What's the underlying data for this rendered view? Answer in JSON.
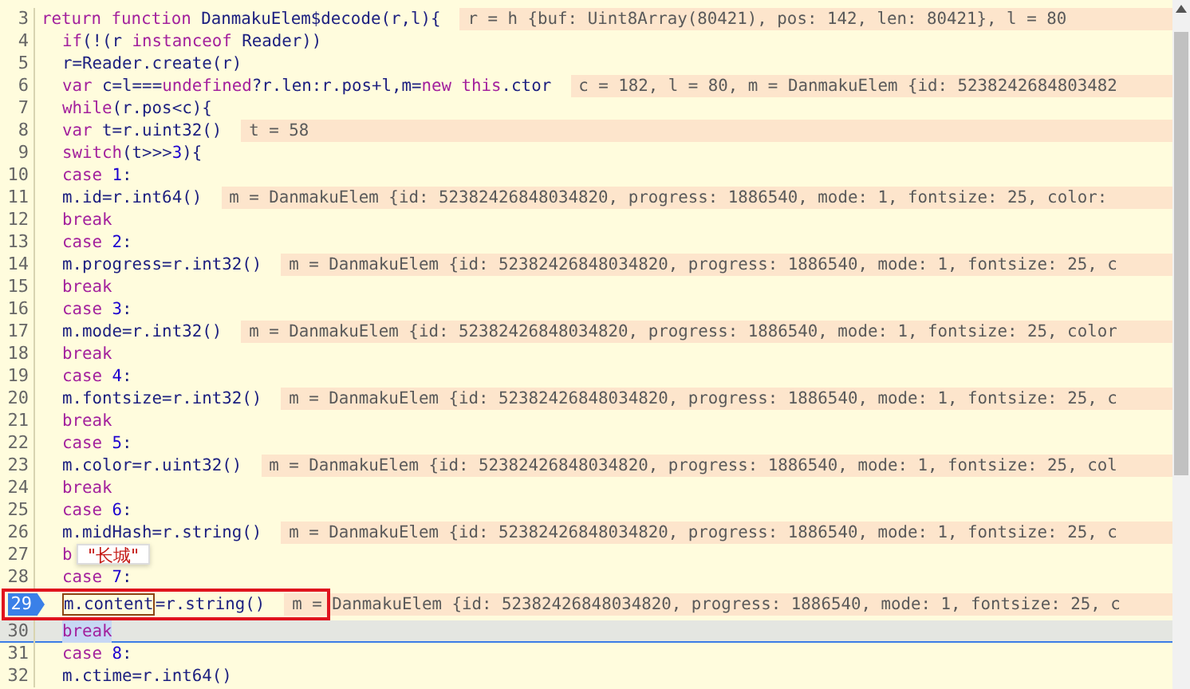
{
  "editor": {
    "lines": [
      {
        "number": "3",
        "paused": false,
        "highlighted": false,
        "tokens": [
          {
            "text": "return function",
            "kind": "keyword"
          },
          {
            "text": " DanmakuElem$decode(r,l){",
            "kind": "plain"
          }
        ],
        "value": "r = h {buf: Uint8Array(80421), pos: 142, len: 80421}, l = 80",
        "children": [
          {
            "number": "4",
            "paused": false,
            "highlighted": false,
            "tokens": [
              {
                "text": "if",
                "kind": "keyword"
              },
              {
                "text": "(!(r ",
                "kind": "plain"
              },
              {
                "text": "instanceof",
                "kind": "keyword"
              },
              {
                "text": " Reader))",
                "kind": "plain"
              }
            ]
          },
          {
            "number": "5",
            "paused": false,
            "highlighted": false,
            "tokens": [
              {
                "text": "r=Reader.create(r)",
                "kind": "plain"
              }
            ]
          },
          {
            "number": "6",
            "paused": false,
            "highlighted": false,
            "tokens": [
              {
                "text": "var",
                "kind": "keyword"
              },
              {
                "text": " c=l===",
                "kind": "plain"
              },
              {
                "text": "undefined",
                "kind": "keyword"
              },
              {
                "text": "?r.len:r.pos+l,m=",
                "kind": "plain"
              },
              {
                "text": "new this",
                "kind": "keyword"
              },
              {
                "text": ".ctor",
                "kind": "plain"
              }
            ],
            "value": "c = 182, l = 80, m = DanmakuElem {id: 5238242684803482"
          },
          {
            "number": "7",
            "paused": false,
            "highlighted": false,
            "tokens": [
              {
                "text": "while",
                "kind": "keyword"
              },
              {
                "text": "(r.pos<c){",
                "kind": "plain"
              }
            ]
          },
          {
            "number": "8",
            "paused": false,
            "highlighted": false,
            "tokens": [
              {
                "text": "var",
                "kind": "keyword"
              },
              {
                "text": " t=r.uint32()",
                "kind": "plain"
              }
            ],
            "value": "t = 58"
          },
          {
            "number": "9",
            "paused": false,
            "highlighted": false,
            "tokens": [
              {
                "text": "switch",
                "kind": "keyword"
              },
              {
                "text": "(t>>>",
                "kind": "plain"
              },
              {
                "text": "3",
                "kind": "number"
              },
              {
                "text": "){",
                "kind": "plain"
              }
            ]
          },
          {
            "number": "10",
            "paused": false,
            "highlighted": false,
            "tokens": [
              {
                "text": "case ",
                "kind": "keyword"
              },
              {
                "text": "1",
                "kind": "number"
              },
              {
                "text": ":",
                "kind": "plain"
              }
            ]
          },
          {
            "number": "11",
            "paused": false,
            "highlighted": false,
            "tokens": [
              {
                "text": "m.id=r.int64()",
                "kind": "plain"
              }
            ],
            "value": "m = DanmakuElem {id: 52382426848034820, progress: 1886540, mode: 1, fontsize: 25, color:"
          },
          {
            "number": "12",
            "paused": false,
            "highlighted": false,
            "tokens": [
              {
                "text": "break",
                "kind": "keyword"
              }
            ]
          },
          {
            "number": "13",
            "paused": false,
            "highlighted": false,
            "tokens": [
              {
                "text": "case ",
                "kind": "keyword"
              },
              {
                "text": "2",
                "kind": "number"
              },
              {
                "text": ":",
                "kind": "plain"
              }
            ]
          },
          {
            "number": "14",
            "paused": false,
            "highlighted": false,
            "tokens": [
              {
                "text": "m.progress=r.int32()",
                "kind": "plain"
              }
            ],
            "value": "m = DanmakuElem {id: 52382426848034820, progress: 1886540, mode: 1, fontsize: 25, c"
          },
          {
            "number": "15",
            "paused": false,
            "highlighted": false,
            "tokens": [
              {
                "text": "break",
                "kind": "keyword"
              }
            ]
          },
          {
            "number": "16",
            "paused": false,
            "highlighted": false,
            "tokens": [
              {
                "text": "case ",
                "kind": "keyword"
              },
              {
                "text": "3",
                "kind": "number"
              },
              {
                "text": ":",
                "kind": "plain"
              }
            ]
          },
          {
            "number": "17",
            "paused": false,
            "highlighted": false,
            "tokens": [
              {
                "text": "m.mode=r.int32()",
                "kind": "plain"
              }
            ],
            "value": "m = DanmakuElem {id: 52382426848034820, progress: 1886540, mode: 1, fontsize: 25, color"
          },
          {
            "number": "18",
            "paused": false,
            "highlighted": false,
            "tokens": [
              {
                "text": "break",
                "kind": "keyword"
              }
            ]
          },
          {
            "number": "19",
            "paused": false,
            "highlighted": false,
            "tokens": [
              {
                "text": "case ",
                "kind": "keyword"
              },
              {
                "text": "4",
                "kind": "number"
              },
              {
                "text": ":",
                "kind": "plain"
              }
            ]
          },
          {
            "number": "20",
            "paused": false,
            "highlighted": false,
            "tokens": [
              {
                "text": "m.fontsize=r.int32()",
                "kind": "plain"
              }
            ],
            "value": "m = DanmakuElem {id: 52382426848034820, progress: 1886540, mode: 1, fontsize: 25, c"
          },
          {
            "number": "21",
            "paused": false,
            "highlighted": false,
            "tokens": [
              {
                "text": "break",
                "kind": "keyword"
              }
            ]
          },
          {
            "number": "22",
            "paused": false,
            "highlighted": false,
            "tokens": [
              {
                "text": "case ",
                "kind": "keyword"
              },
              {
                "text": "5",
                "kind": "number"
              },
              {
                "text": ":",
                "kind": "plain"
              }
            ]
          },
          {
            "number": "23",
            "paused": false,
            "highlighted": false,
            "tokens": [
              {
                "text": "m.color=r.uint32()",
                "kind": "plain"
              }
            ],
            "value": "m = DanmakuElem {id: 52382426848034820, progress: 1886540, mode: 1, fontsize: 25, col"
          },
          {
            "number": "24",
            "paused": false,
            "highlighted": false,
            "tokens": [
              {
                "text": "break",
                "kind": "keyword"
              }
            ]
          },
          {
            "number": "25",
            "paused": false,
            "highlighted": false,
            "tokens": [
              {
                "text": "case ",
                "kind": "keyword"
              },
              {
                "text": "6",
                "kind": "number"
              },
              {
                "text": ":",
                "kind": "plain"
              }
            ]
          },
          {
            "number": "26",
            "paused": false,
            "highlighted": false,
            "tokens": [
              {
                "text": "m.midHash=r.string()",
                "kind": "plain"
              }
            ],
            "value": "m = DanmakuElem {id: 52382426848034820, progress: 1886540, mode: 1, fontsize: 25, c"
          },
          {
            "number": "27",
            "paused": false,
            "highlighted": false,
            "tokens": [
              {
                "text": "b",
                "kind": "keyword"
              }
            ]
          },
          {
            "number": "28",
            "paused": false,
            "highlighted": false,
            "tokens": [
              {
                "text": "case ",
                "kind": "keyword"
              },
              {
                "text": "7",
                "kind": "number"
              },
              {
                "text": ":",
                "kind": "plain"
              }
            ]
          },
          {
            "number": "29",
            "paused": true,
            "highlighted": false,
            "tokens": [
              {
                "text": "m.content",
                "kind": "hovered"
              },
              {
                "text": "=r.string()",
                "kind": "plain"
              }
            ],
            "value": "m = DanmakuElem {id: 52382426848034820, progress: 1886540, mode: 1, fontsize: 25, c"
          },
          {
            "number": "30",
            "paused": false,
            "highlighted": true,
            "tokens": [
              {
                "text": "break",
                "kind": "selected"
              }
            ]
          },
          {
            "number": "31",
            "paused": false,
            "highlighted": false,
            "tokens": [
              {
                "text": "case ",
                "kind": "keyword"
              },
              {
                "text": "8",
                "kind": "number"
              },
              {
                "text": ":",
                "kind": "plain"
              }
            ]
          },
          {
            "number": "32",
            "paused": false,
            "highlighted": false,
            "tokens": [
              {
                "text": "m.ctime=r.int64()",
                "kind": "plain"
              }
            ]
          }
        ]
      }
    ]
  },
  "tooltip": {
    "text": "\"长城\""
  }
}
